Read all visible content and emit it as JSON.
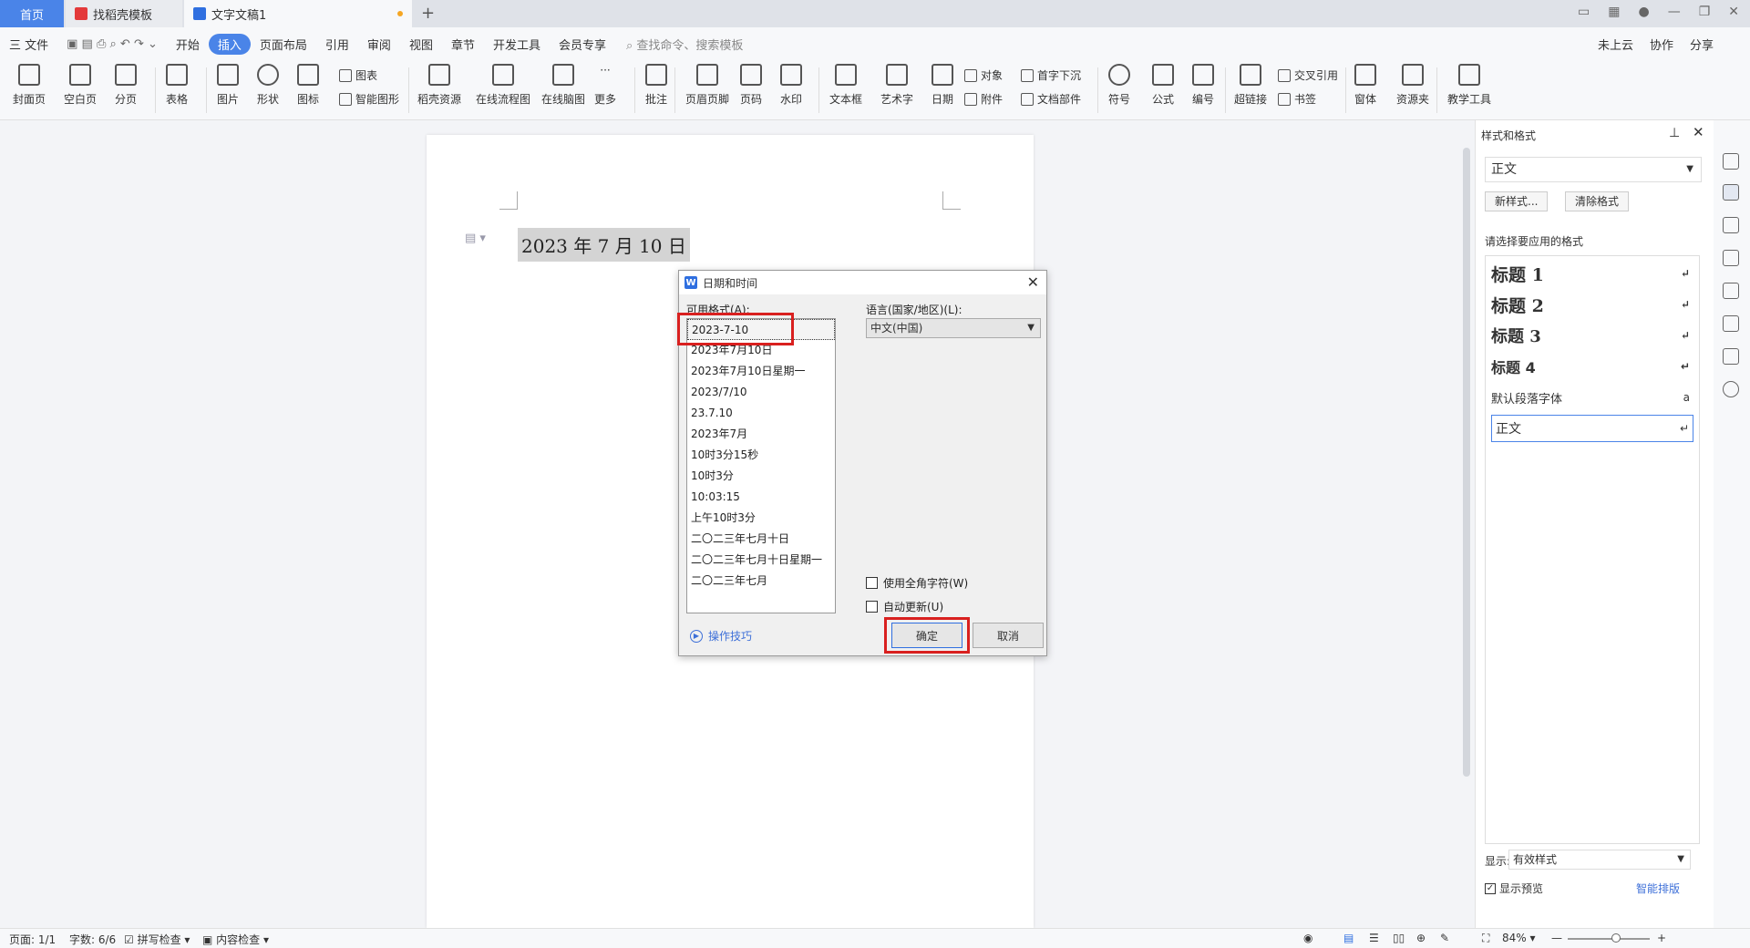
{
  "tabs": {
    "home": "首页",
    "template": "找稻壳模板",
    "doc": "文字文稿1"
  },
  "menu": {
    "file": "三 文件",
    "items": [
      "开始",
      "插入",
      "页面布局",
      "引用",
      "审阅",
      "视图",
      "章节",
      "开发工具",
      "会员专享"
    ],
    "active": "插入",
    "search": "查找命令、搜索模板",
    "right": [
      "未上云",
      "协作",
      "分享"
    ]
  },
  "ribbon": {
    "big": [
      "封面页",
      "空白页",
      "分页",
      "表格",
      "图片",
      "形状",
      "图标",
      "稻壳资源",
      "在线流程图",
      "在线脑图",
      "更多",
      "批注",
      "页眉页脚",
      "页码",
      "水印",
      "文本框",
      "艺术字",
      "日期",
      "符号",
      "公式",
      "编号",
      "超链接",
      "窗体",
      "资源夹",
      "教学工具"
    ],
    "small": [
      "图表",
      "智能图形",
      "对象",
      "附件",
      "首字下沉",
      "文档部件",
      "交叉引用",
      "书签"
    ]
  },
  "document": {
    "text": "2023 年 7 月 10 日"
  },
  "dialog": {
    "title": "日期和时间",
    "formats_label": "可用格式(A):",
    "formats": [
      "2023-7-10",
      "2023年7月10日",
      "2023年7月10日星期一",
      "2023/7/10",
      "23.7.10",
      "2023年7月",
      "10时3分15秒",
      "10时3分",
      "10:03:15",
      "上午10时3分",
      "二〇二三年七月十日",
      "二〇二三年七月十日星期一",
      "二〇二三年七月"
    ],
    "selected_index": 0,
    "language_label": "语言(国家/地区)(L):",
    "language_value": "中文(中国)",
    "fullwidth_label": "使用全角字符(W)",
    "autoupdate_label": "自动更新(U)",
    "tips": "操作技巧",
    "ok": "确定",
    "cancel": "取消",
    "highlight_color": "#d9201f"
  },
  "panel": {
    "title": "样式和格式",
    "current_style": "正文",
    "new_style": "新样式...",
    "clear_format": "清除格式",
    "prompt": "请选择要应用的格式",
    "styles": [
      "标题 1",
      "标题 2",
      "标题 3",
      "标题 4",
      "默认段落字体",
      "正文"
    ],
    "display_label": "显示:",
    "display_value": "有效样式",
    "preview_label": "显示预览",
    "smart_layout": "智能排版"
  },
  "status": {
    "page": "页面: 1/1",
    "words": "字数: 6/6",
    "spell": "拼写检查",
    "content": "内容检查",
    "zoom": "84%"
  },
  "colors": {
    "accent": "#4a84e8"
  }
}
